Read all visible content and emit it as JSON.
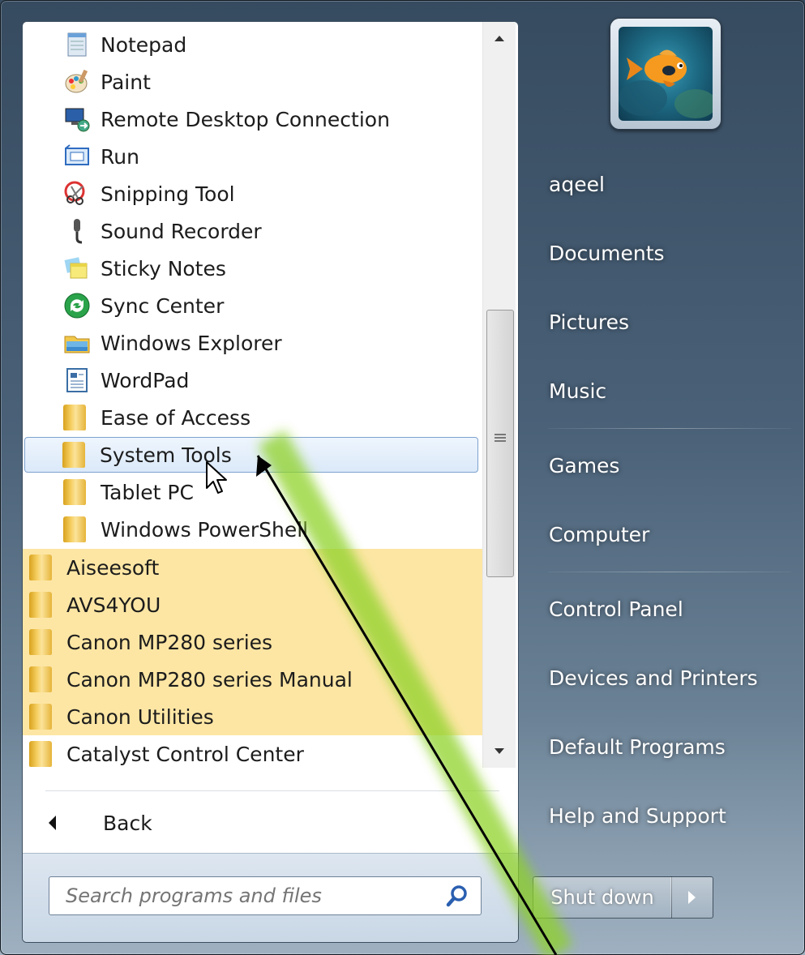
{
  "accessories_items": [
    {
      "label": "Notepad",
      "icon": "notepad-icon"
    },
    {
      "label": "Paint",
      "icon": "paint-icon"
    },
    {
      "label": "Remote Desktop Connection",
      "icon": "remote-desktop-icon"
    },
    {
      "label": "Run",
      "icon": "run-icon"
    },
    {
      "label": "Snipping Tool",
      "icon": "snipping-tool-icon"
    },
    {
      "label": "Sound Recorder",
      "icon": "microphone-icon"
    },
    {
      "label": "Sticky Notes",
      "icon": "sticky-notes-icon"
    },
    {
      "label": "Sync Center",
      "icon": "sync-icon"
    },
    {
      "label": "Windows Explorer",
      "icon": "explorer-icon"
    },
    {
      "label": "WordPad",
      "icon": "wordpad-icon"
    },
    {
      "label": "Ease of Access",
      "icon": "folder-icon"
    },
    {
      "label": "System Tools",
      "icon": "folder-icon",
      "selected": true
    },
    {
      "label": "Tablet PC",
      "icon": "folder-icon"
    },
    {
      "label": "Windows PowerShell",
      "icon": "folder-icon"
    }
  ],
  "program_folders": [
    {
      "label": "Aiseesoft",
      "new": true
    },
    {
      "label": "AVS4YOU",
      "new": true
    },
    {
      "label": "Canon MP280 series",
      "new": true
    },
    {
      "label": "Canon MP280 series Manual",
      "new": true
    },
    {
      "label": "Canon Utilities",
      "new": true
    },
    {
      "label": "Catalyst Control Center",
      "new": false
    }
  ],
  "back_label": "Back",
  "search": {
    "placeholder": "Search programs and files"
  },
  "user": {
    "name": "aqeel"
  },
  "right_menu": [
    {
      "label": "Documents"
    },
    {
      "label": "Pictures"
    },
    {
      "label": "Music"
    },
    {
      "label": "Games"
    },
    {
      "label": "Computer"
    },
    {
      "label": "Control Panel"
    },
    {
      "label": "Devices and Printers"
    },
    {
      "label": "Default Programs"
    },
    {
      "label": "Help and Support"
    }
  ],
  "shutdown_label": "Shut down",
  "colors": {
    "new_program_highlight": "#fde6a4",
    "selection_border": "#7da2ce",
    "aero_panel": "#4a6178",
    "annotation_arrow": "#000000",
    "annotation_glow": "#8fd12a"
  }
}
